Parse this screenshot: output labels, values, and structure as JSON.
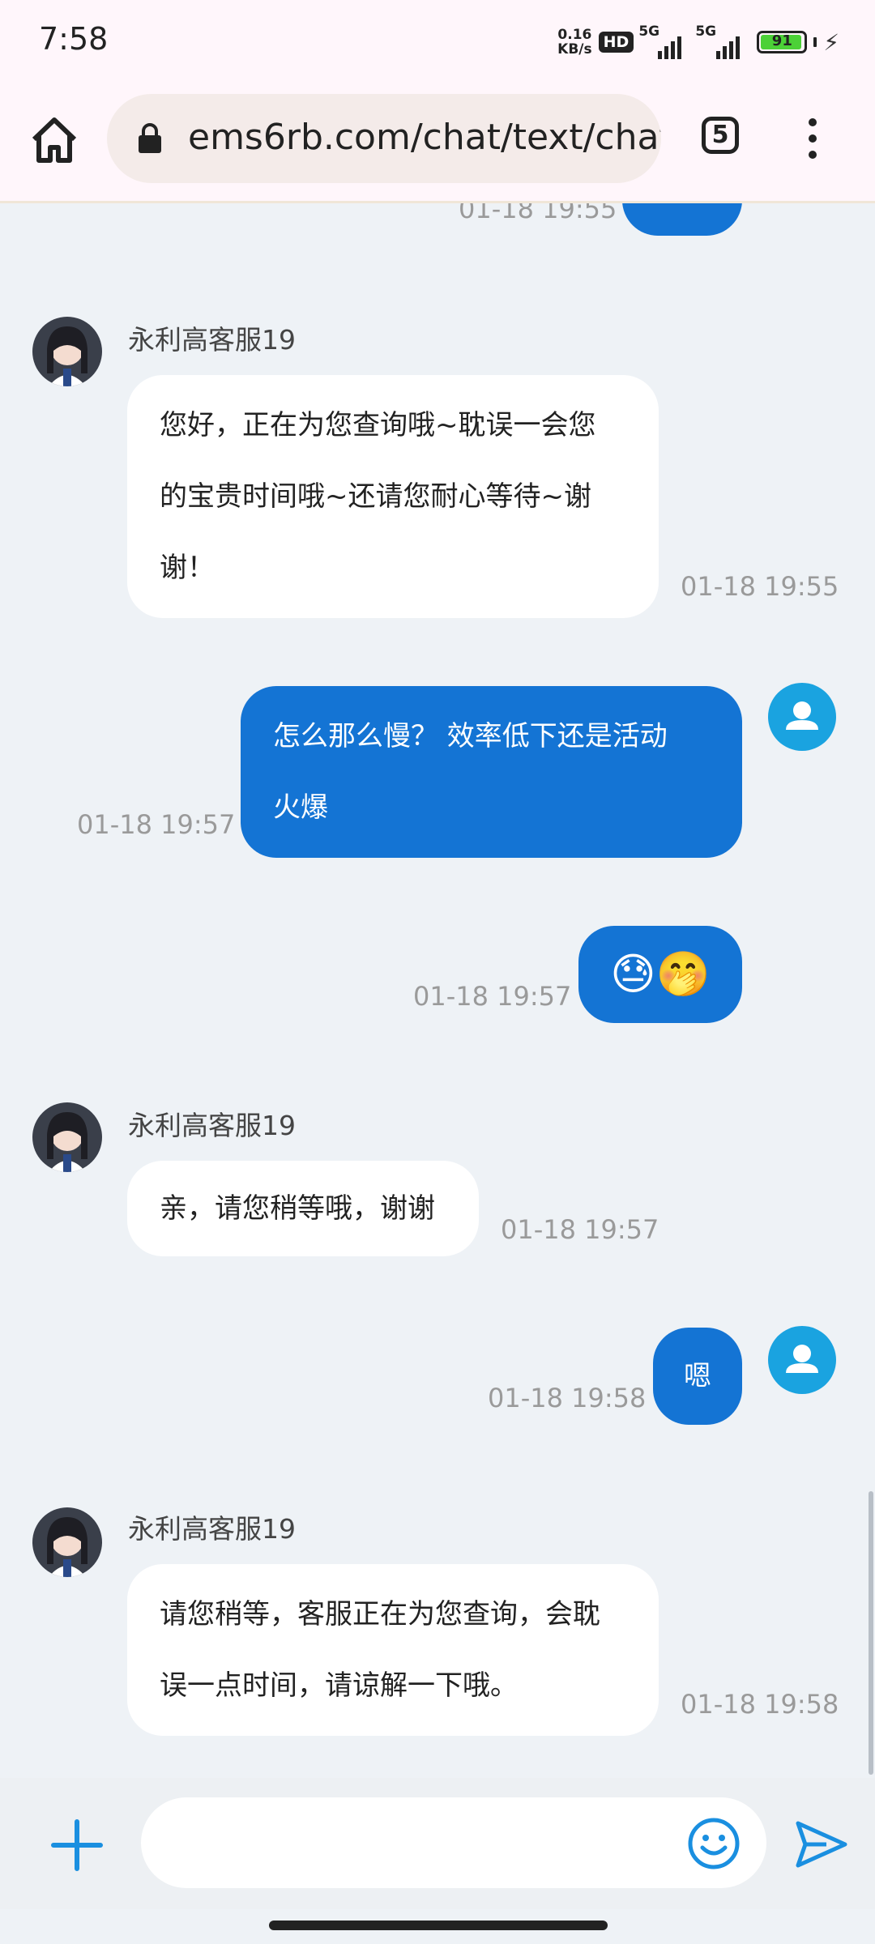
{
  "status_bar": {
    "time": "7:58",
    "net_speed_value": "0.16",
    "net_speed_unit": "KB/s",
    "hd_badge": "HD",
    "signal1_label": "5G",
    "signal2_label": "5G",
    "battery_level": "91"
  },
  "browser": {
    "url": "ems6rb.com/chat/text/chat_",
    "tab_count": "5"
  },
  "chat": {
    "messages": [
      {
        "type": "out",
        "timestamp": "01-18 19:55"
      },
      {
        "type": "in",
        "sender": "永利高客服19",
        "lines": [
          "您好，正在为您查询哦~耽误一会您",
          "的宝贵时间哦~还请您耐心等待~谢",
          "谢！"
        ],
        "timestamp": "01-18 19:55"
      },
      {
        "type": "out",
        "lines": [
          "怎么那么慢？ 效率低下还是活动",
          "火爆"
        ],
        "timestamp": "01-18 19:57"
      },
      {
        "type": "out",
        "text": "😓🤭",
        "timestamp": "01-18 19:57"
      },
      {
        "type": "in",
        "sender": "永利高客服19",
        "text": "亲，请您稍等哦，谢谢",
        "timestamp": "01-18 19:57"
      },
      {
        "type": "out",
        "text": "嗯",
        "timestamp": "01-18 19:58"
      },
      {
        "type": "in",
        "sender": "永利高客服19",
        "lines": [
          "请您稍等，客服正在为您查询，会耽",
          "误一点时间，请谅解一下哦。"
        ],
        "timestamp": "01-18 19:58"
      }
    ]
  },
  "input_bar": {
    "placeholder": "",
    "accent_color": "#1a8fe0"
  },
  "colors": {
    "outgoing_bubble": "#1474d4",
    "user_avatar": "#1aa3e0",
    "background": "#eef2f6"
  }
}
